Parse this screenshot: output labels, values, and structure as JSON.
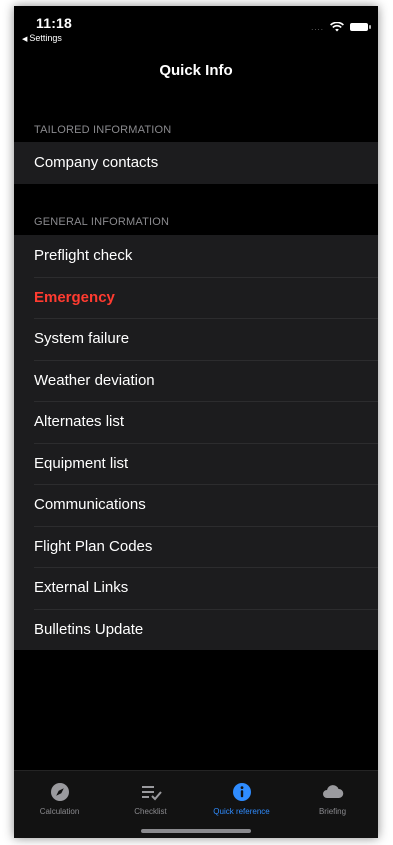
{
  "status_bar": {
    "time": "11:18",
    "back_app": "Settings",
    "signal": "....",
    "wifi_icon": "wifi-icon",
    "battery_icon": "battery-icon"
  },
  "nav": {
    "title": "Quick Info"
  },
  "sections": {
    "tailored": {
      "header": "TAILORED INFORMATION",
      "items": [
        {
          "label": "Company contacts"
        }
      ]
    },
    "general": {
      "header": "GENERAL INFORMATION",
      "items": [
        {
          "label": "Preflight check"
        },
        {
          "label": "Emergency",
          "highlight": "#ff3b30"
        },
        {
          "label": "System failure"
        },
        {
          "label": "Weather deviation"
        },
        {
          "label": "Alternates list"
        },
        {
          "label": "Equipment list"
        },
        {
          "label": "Communications"
        },
        {
          "label": "Flight Plan Codes"
        },
        {
          "label": "External Links"
        },
        {
          "label": "Bulletins Update"
        }
      ]
    }
  },
  "tab_bar": {
    "items": [
      {
        "label": "Calculation",
        "icon": "compass-icon"
      },
      {
        "label": "Checklist",
        "icon": "checklist-icon"
      },
      {
        "label": "Quick reference",
        "icon": "info-icon",
        "active": true
      },
      {
        "label": "Briefing",
        "icon": "cloud-icon"
      }
    ],
    "active_color": "#2f8cff",
    "inactive_color": "#8a8a8e"
  },
  "colors": {
    "background": "#000000",
    "cell_background": "#1c1c1e",
    "emergency": "#ff3b30"
  }
}
